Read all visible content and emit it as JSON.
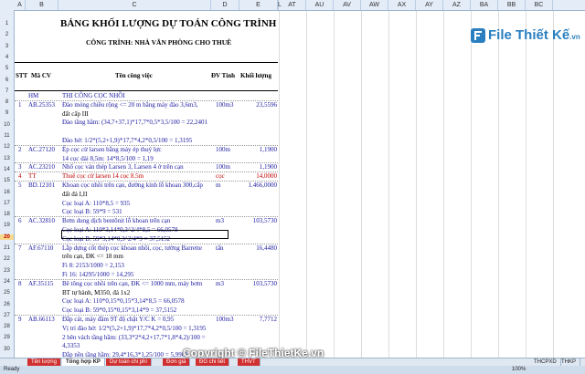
{
  "columns": [
    "A",
    "B",
    "C",
    "D",
    "E",
    "L",
    "AT",
    "AU",
    "AV",
    "AW",
    "AX",
    "AY",
    "AZ",
    "BA",
    "BB",
    "BC"
  ],
  "row_numbers": [
    "1",
    "2",
    "3",
    "4",
    "5",
    "6",
    "7",
    "8",
    "9",
    "10",
    "11",
    "12",
    "13",
    "14",
    "15",
    "16",
    "17",
    "18",
    "19",
    "20",
    "21",
    "22",
    "23",
    "24",
    "25",
    "26",
    "27",
    "28",
    "29",
    "30"
  ],
  "selected_row": "20",
  "sheet": {
    "title": "BẢNG KHỐI LƯỢNG DỰ TOÁN CÔNG TRÌNH",
    "subtitle": "CÔNG TRÌNH: NHÀ VĂN PHÒNG CHO THUÊ",
    "headers": {
      "stt": "STT",
      "ma_cv": "Mã CV",
      "ten": "Tên công việc",
      "dvt": "ĐV Tính",
      "kl": "Khối lượng"
    },
    "rows": [
      {
        "stt": "",
        "ma": "HM",
        "ten": "THI CÔNG CỌC NHỒI",
        "dvt": "",
        "kl": "",
        "style": "blue"
      },
      {
        "stt": "1",
        "ma": "AB.25353",
        "ten": "Đào móng chiều rộng <= 20 m bằng máy đào 3,6m3,",
        "dvt": "100m3",
        "kl": "23,5596",
        "style": "blue"
      },
      {
        "stt": "",
        "ma": "",
        "ten": "đất cấp III",
        "dvt": "",
        "kl": "",
        "style": ""
      },
      {
        "stt": "",
        "ma": "",
        "ten": "Đào tầng hầm: (34,7+37,1)*17,7*0,5*3,5/100 = 22,2401",
        "dvt": "",
        "kl": "",
        "style": "blue"
      },
      {
        "stt": "",
        "ma": "",
        "ten": "",
        "dvt": "",
        "kl": "",
        "style": ""
      },
      {
        "stt": "",
        "ma": "",
        "ten": "Đào hở: 1/2*(5,2+1,9)*17,7*4,2*0,5/100 = 1,3195",
        "dvt": "",
        "kl": "",
        "style": "blue"
      },
      {
        "stt": "2",
        "ma": "AC.27120",
        "ten": "Ép cọc cừ larsen bằng máy ép thuỷ lực",
        "dvt": "100m",
        "kl": "1,1900",
        "style": "blue"
      },
      {
        "stt": "",
        "ma": "",
        "ten": "14 cọc dài 8,5m: 14*8,5/100 = 1,19",
        "dvt": "",
        "kl": "",
        "style": "blue"
      },
      {
        "stt": "3",
        "ma": "AC.23210",
        "ten": "Nhổ cọc ván thép Larsen 3, Larsen 4 ở trên cạn",
        "dvt": "100m",
        "kl": "1,1900",
        "style": "blue"
      },
      {
        "stt": "4",
        "ma": "TT",
        "ten": "Thuê cọc cừ larsen 14 cọc 8.5m",
        "dvt": "cọc",
        "kl": "14,0000",
        "style": "red"
      },
      {
        "stt": "5",
        "ma": "BD.12101",
        "ten": "Khoan cọc nhồi trên cạn, đường kính lỗ khoan 300,cấp",
        "dvt": "m",
        "kl": "1.466,0000",
        "style": "blue"
      },
      {
        "stt": "",
        "ma": "",
        "ten": "đất đá I,II",
        "dvt": "",
        "kl": "",
        "style": ""
      },
      {
        "stt": "",
        "ma": "",
        "ten": "Cọc loại A: 110*8,5 = 935",
        "dvt": "",
        "kl": "",
        "style": "blue"
      },
      {
        "stt": "",
        "ma": "",
        "ten": "Cọc loại B: 59*9 = 531",
        "dvt": "",
        "kl": "",
        "style": "blue"
      },
      {
        "stt": "6",
        "ma": "AC.32810",
        "ten": "Bơm dung dịch bentônit lỗ khoan trên cạn",
        "dvt": "m3",
        "kl": "103,5730",
        "style": "blue"
      },
      {
        "stt": "",
        "ma": "",
        "ten": "Cọc loại A: 110*3,14*0,3^2/4*8,5 = 66,0578",
        "dvt": "",
        "kl": "",
        "style": "blue"
      },
      {
        "stt": "",
        "ma": "",
        "ten": "Cọc loại B: 59*3,14*0,3^2/4*9 = 37,5152",
        "dvt": "",
        "kl": "",
        "style": "blue"
      },
      {
        "stt": "7",
        "ma": "AF.67110",
        "ten": "Lắp dựng cốt thép cọc khoan nhồi, cọc, tường Barrette",
        "dvt": "tấn",
        "kl": "16,4480",
        "style": "blue"
      },
      {
        "stt": "",
        "ma": "",
        "ten": "trên cạn, ĐK <= 18 mm",
        "dvt": "",
        "kl": "",
        "style": ""
      },
      {
        "stt": "",
        "ma": "",
        "ten": "Fi 8: 2153/1000 = 2,153",
        "dvt": "",
        "kl": "",
        "style": "blue"
      },
      {
        "stt": "",
        "ma": "",
        "ten": "Fi 16: 14295/1000 = 14,295",
        "dvt": "",
        "kl": "",
        "style": "blue"
      },
      {
        "stt": "8",
        "ma": "AF.35115",
        "ten": "Bê tông cọc nhồi trên cạn, ĐK <= 1000 mm, máy bơm",
        "dvt": "m3",
        "kl": "103,5730",
        "style": "blue"
      },
      {
        "stt": "",
        "ma": "",
        "ten": "BT tự hành, M350, đá 1x2",
        "dvt": "",
        "kl": "",
        "style": ""
      },
      {
        "stt": "",
        "ma": "",
        "ten": "Cọc loại A: 110*0,15*0,15*3,14*8,5 = 66,0578",
        "dvt": "",
        "kl": "",
        "style": "blue"
      },
      {
        "stt": "",
        "ma": "",
        "ten": "Cọc loại B: 59*0,15*0,15*3,14*9 = 37,5152",
        "dvt": "",
        "kl": "",
        "style": "blue"
      },
      {
        "stt": "9",
        "ma": "AB.66113",
        "ten": "Đắp cát, máy đầm 9T độ chặt Y/C K = 0,95",
        "dvt": "100m3",
        "kl": "7,7712",
        "style": "blue"
      },
      {
        "stt": "",
        "ma": "",
        "ten": "Vị trí đào hở: 1/2*(5,2+1,9)*17,7*4,2*0,5/100 = 1,3195",
        "dvt": "",
        "kl": "",
        "style": "blue"
      },
      {
        "stt": "",
        "ma": "",
        "ten": "2 bên vách tầng hầm: (33,3*2*4,2+17,7*1,8*4,2)/100 =",
        "dvt": "",
        "kl": "",
        "style": "blue"
      },
      {
        "stt": "",
        "ma": "",
        "ten": "4,3353",
        "dvt": "",
        "kl": "",
        "style": "blue"
      },
      {
        "stt": "",
        "ma": "",
        "ten": "Đắp nền tầng hầm: 29,4*16,3*1,25/100 = 5,9902",
        "dvt": "",
        "kl": "",
        "style": "blue"
      }
    ]
  },
  "logo": {
    "name": "File Thiết Kế",
    "suffix": ".vn"
  },
  "footer": "Copyright © FileThietKe.vn",
  "tabs": [
    "Tên lượng",
    "Tổng hợp KP",
    "Dự toán chi phí",
    "Đơn giá",
    "ĐG chi tiết",
    "THVT",
    "THCPXD",
    "THKP"
  ],
  "status": {
    "text": "Ready",
    "zoom": "100%"
  },
  "colors": {
    "blue": "#1a1aa0",
    "red": "#c00000",
    "header_bg": "#e4ecf7"
  }
}
